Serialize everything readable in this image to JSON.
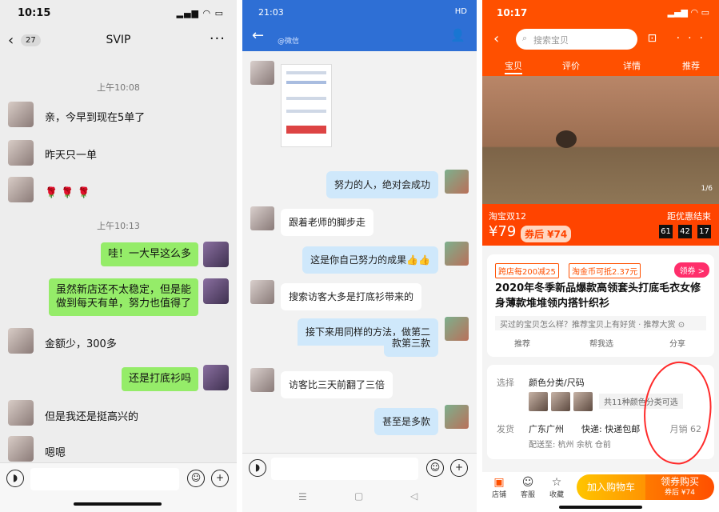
{
  "wechat": {
    "status_time": "10:15",
    "unread_badge": "27",
    "chat_title": "SVIP",
    "timestamps": [
      "上午10:08",
      "上午10:13"
    ],
    "messages_in": [
      "亲，今早到现在5单了",
      "昨天只一单",
      "🌹 🌹 🌹",
      "金额少，300多",
      "但是我还是挺高兴的",
      "嗯嗯"
    ],
    "messages_out": [
      "哇！一大早这么多",
      "虽然新店还不太稳定，但是能",
      "做到每天有单，努力也值得了",
      "还是打底衫吗"
    ]
  },
  "qq": {
    "status_time": "21:03",
    "status_right": "HD",
    "subtitle": "@微信",
    "messages": [
      {
        "side": "out",
        "text": "努力的人，绝对会成功"
      },
      {
        "side": "in",
        "text": "跟着老师的脚步走"
      },
      {
        "side": "out",
        "text": "这是你自己努力的成果👍👍"
      },
      {
        "side": "in",
        "text": "搜索访客大多是打底衫带来的"
      },
      {
        "side": "out",
        "text": "接下来用同样的方法，做第二"
      },
      {
        "side": "out",
        "text": "款第三款"
      },
      {
        "side": "in",
        "text": "访客比三天前翻了三倍"
      },
      {
        "side": "out",
        "text": "甚至是多款"
      }
    ]
  },
  "taobao": {
    "status_time": "10:17",
    "search_placeholder": "搜索宝贝",
    "tabs": [
      "宝贝",
      "评价",
      "详情",
      "推荐"
    ],
    "page_indicator": "1/6",
    "promo_title": "淘宝双12",
    "price": "¥79",
    "coupon_price": "券后 ¥74",
    "countdown_label": "距优惠结束",
    "countdown": [
      "61",
      "42",
      "17"
    ],
    "tag_cross_store": "跨店每200减25",
    "tag_coin": "淘金币可抵2.37元",
    "tag_coupon": "领券 >",
    "product_title": "2020年冬季新品爆款高领套头打底毛衣女修身薄款堆堆领内搭针织衫",
    "ask_text": "买过的宝贝怎么样？推荐宝贝上有好货 · 推荐大赏 ⊙",
    "actions": [
      "推荐",
      "帮我选",
      "分享"
    ],
    "select_label": "选择",
    "select_value": "颜色分类/尺码",
    "color_count": "共11种颜色分类可选",
    "ship_label": "发货",
    "ship_from": "广东广州",
    "ship_type": "快递: 快递包邮",
    "ship_to": "配送至: 杭州 余杭 仓前",
    "monthly_sales": "月销 62",
    "bottom_icons": [
      "店铺",
      "客服",
      "收藏"
    ],
    "add_cart": "加入购物车",
    "buy_label": "领券购买",
    "buy_sub": "券后 ¥74"
  }
}
